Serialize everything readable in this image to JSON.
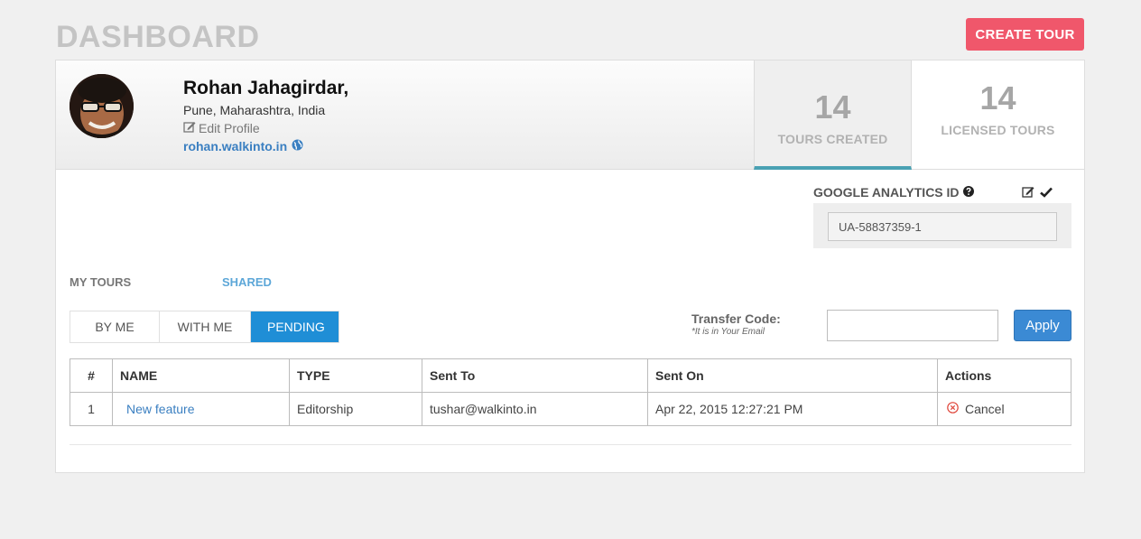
{
  "page": {
    "title": "DASHBOARD",
    "create_label": "CREATE TOUR"
  },
  "profile": {
    "name": "Rohan Jahagirdar,",
    "location": "Pune, Maharashtra, India",
    "edit_label": "Edit Profile",
    "website": "rohan.walkinto.in"
  },
  "stats": {
    "created": {
      "value": "14",
      "label": "TOURS CREATED"
    },
    "licensed": {
      "value": "14",
      "label": "LICENSED TOURS"
    }
  },
  "analytics": {
    "label": "GOOGLE ANALYTICS ID",
    "value": "UA-58837359-1"
  },
  "tabs": {
    "my_tours": "MY TOURS",
    "shared": "SHARED"
  },
  "filters": [
    {
      "label": "BY ME",
      "active": false
    },
    {
      "label": "WITH ME",
      "active": false
    },
    {
      "label": "PENDING",
      "active": true
    }
  ],
  "transfer": {
    "label": "Transfer Code:",
    "hint": "*It is in Your Email",
    "value": "",
    "apply_label": "Apply"
  },
  "table": {
    "headers": [
      "#",
      "NAME",
      "TYPE",
      "Sent To",
      "Sent On",
      "Actions"
    ],
    "rows": [
      {
        "num": "1",
        "name": "New feature",
        "type": "Editorship",
        "sent_to": "tushar@walkinto.in",
        "sent_on": "Apr 22, 2015 12:27:21 PM",
        "action": "Cancel"
      }
    ]
  },
  "colors": {
    "accent": "#f0576b",
    "primary": "#1f8ed6",
    "link": "#3a7fc1",
    "tab_underline": "#4aa1b3"
  },
  "icons": [
    "edit-icon",
    "globe-icon",
    "question-icon",
    "check-icon",
    "cancel-icon"
  ]
}
